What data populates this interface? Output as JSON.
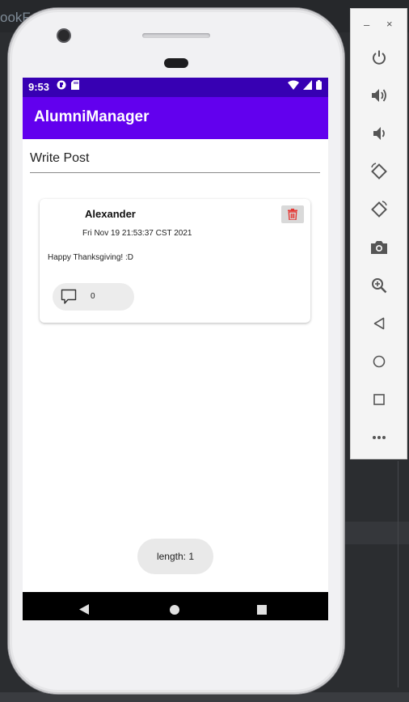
{
  "ide": {
    "tab_fragment": "ookF",
    "left_glyph": ")"
  },
  "status_bar": {
    "time": "9:53"
  },
  "app": {
    "title": "AlumniManager",
    "accent": "#6200ee",
    "status_color": "#3700b3"
  },
  "compose": {
    "placeholder": "Write Post"
  },
  "post": {
    "author": "Alexander",
    "date": "Fri Nov 19 21:53:37 CST 2021",
    "body": "Happy Thanksgiving! :D",
    "comment_count": "0",
    "delete_color": "#e53935"
  },
  "toast": {
    "text": "length: 1"
  },
  "nav": {
    "icons": [
      "back-icon",
      "home-icon",
      "recents-icon"
    ]
  },
  "emulator": {
    "minimize_label": "–",
    "close_label": "×",
    "buttons": [
      "power-icon",
      "volume-up-icon",
      "volume-down-icon",
      "rotate-left-icon",
      "rotate-right-icon",
      "camera-icon",
      "zoom-icon",
      "back-icon",
      "home-icon",
      "overview-icon",
      "more-icon"
    ]
  }
}
